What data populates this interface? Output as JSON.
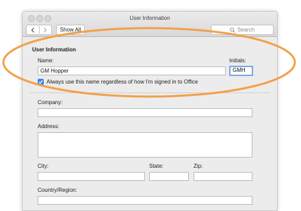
{
  "window": {
    "title": "User Information"
  },
  "toolbar": {
    "show_all_label": "Show All",
    "search_placeholder": "Search"
  },
  "user_info": {
    "section_title": "User Information",
    "name_label": "Name:",
    "name_value": "GM Hopper",
    "initials_label": "Initials:",
    "initials_value": "GMH",
    "always_use_label": "Always use this name regardless of how I'm signed in to Office",
    "always_use_checked": true
  },
  "address_form": {
    "company_label": "Company:",
    "address_label": "Address:",
    "city_label": "City:",
    "state_label": "State:",
    "zip_label": "Zip:",
    "country_label": "Country/Region:"
  },
  "annotation": {
    "highlight_color": "#f2a04a"
  },
  "colors": {
    "checkbox_blue": "#3d85ec",
    "focus_ring": "#7aa7e6"
  }
}
